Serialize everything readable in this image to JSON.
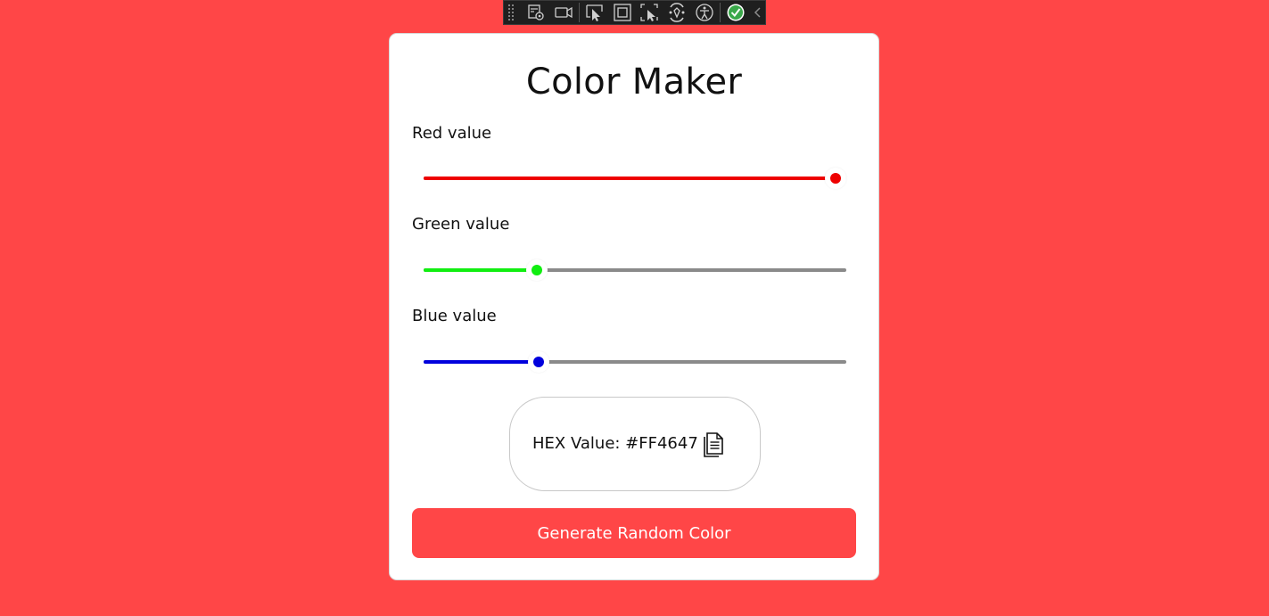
{
  "devtools_toolbar": {
    "tools": [
      {
        "icon": "live-visual-tree-icon"
      },
      {
        "icon": "record-video-icon"
      },
      {
        "icon": "select-element-icon"
      },
      {
        "icon": "display-layout-adorners-icon"
      },
      {
        "icon": "track-focus-icon"
      },
      {
        "icon": "hot-reload-icon"
      },
      {
        "icon": "accessibility-icon"
      },
      {
        "icon": "binding-check-icon"
      },
      {
        "icon": "collapse-chevron-icon"
      }
    ]
  },
  "app": {
    "title": "Color Maker",
    "background_color": "#FF4647",
    "sliders": [
      {
        "label": "Red value",
        "value": 255,
        "max": 255,
        "color": "#EE0000"
      },
      {
        "label": "Green value",
        "value": 70,
        "max": 255,
        "color": "#11EE11"
      },
      {
        "label": "Blue value",
        "value": 71,
        "max": 255,
        "color": "#0000DD"
      }
    ],
    "hex": {
      "text": "HEX Value: #FF4647",
      "copy_icon": "copy-document-icon"
    },
    "generate_button_label": "Generate Random Color"
  }
}
